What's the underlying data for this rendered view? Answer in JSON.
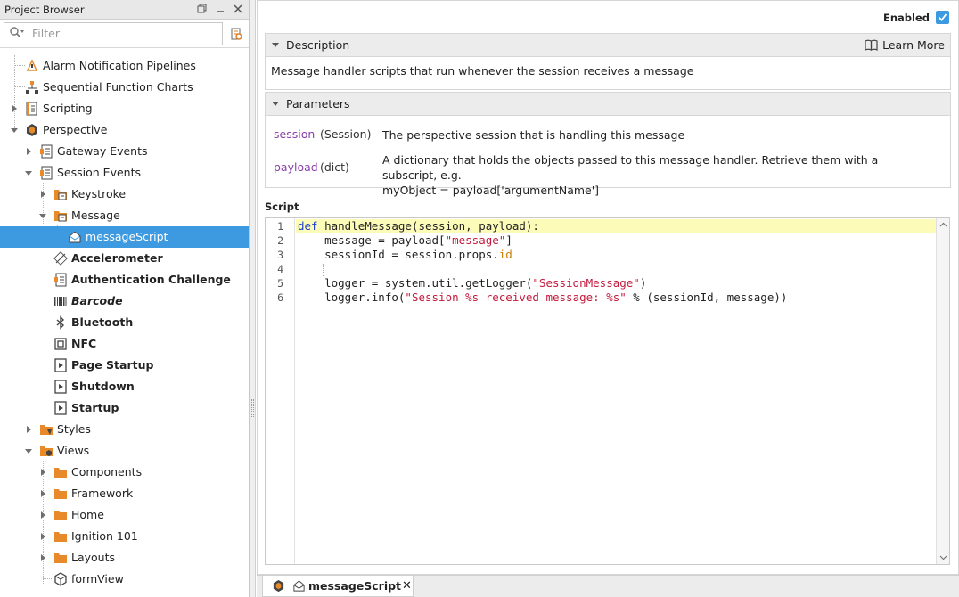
{
  "project_browser": {
    "title": "Project Browser",
    "filter_placeholder": "Filter",
    "tree": [
      {
        "label": "Alarm Notification Pipelines",
        "icon": "alarm-pipeline-icon"
      },
      {
        "label": "Sequential Function Charts",
        "icon": "sfc-icon"
      },
      {
        "label": "Scripting",
        "icon": "scripting-icon",
        "expanded": false
      },
      {
        "label": "Perspective",
        "icon": "perspective-icon",
        "expanded": true
      },
      {
        "label": "Gateway Events",
        "icon": "script-doc-icon",
        "expanded": false
      },
      {
        "label": "Session Events",
        "icon": "script-doc-icon",
        "expanded": true
      },
      {
        "label": "Keystroke",
        "icon": "folder-script-icon",
        "expanded": false
      },
      {
        "label": "Message",
        "icon": "folder-script-icon",
        "expanded": true
      },
      {
        "label": "messageScript",
        "icon": "message-script-icon",
        "selected": true
      },
      {
        "label": "Accelerometer",
        "icon": "accelerometer-icon"
      },
      {
        "label": "Authentication Challenge",
        "icon": "script-doc-icon"
      },
      {
        "label": "Barcode",
        "icon": "barcode-icon"
      },
      {
        "label": "Bluetooth",
        "icon": "bluetooth-icon"
      },
      {
        "label": "NFC",
        "icon": "nfc-icon"
      },
      {
        "label": "Page Startup",
        "icon": "page-play-icon"
      },
      {
        "label": "Shutdown",
        "icon": "page-play-icon"
      },
      {
        "label": "Startup",
        "icon": "page-play-icon"
      },
      {
        "label": "Styles",
        "icon": "folder-styles-icon",
        "expanded": false
      },
      {
        "label": "Views",
        "icon": "folder-views-icon",
        "expanded": true
      },
      {
        "label": "Components",
        "icon": "folder-icon",
        "expanded": false
      },
      {
        "label": "Framework",
        "icon": "folder-icon",
        "expanded": false
      },
      {
        "label": "Home",
        "icon": "folder-icon",
        "expanded": false
      },
      {
        "label": "Ignition 101",
        "icon": "folder-icon",
        "expanded": false
      },
      {
        "label": "Layouts",
        "icon": "folder-icon",
        "expanded": false
      },
      {
        "label": "formView",
        "icon": "view-icon"
      }
    ]
  },
  "editor": {
    "enabled_label": "Enabled",
    "enabled": true,
    "description": {
      "header": "Description",
      "learn_more": "Learn More",
      "text": "Message handler scripts that run whenever the session receives a message"
    },
    "parameters": {
      "header": "Parameters",
      "items": [
        {
          "name": "session",
          "type": "(Session)",
          "desc": "The perspective session that is handling this message"
        },
        {
          "name": "payload",
          "type": "(dict)",
          "desc_line1": "A dictionary that holds the objects passed to this message handler. Retrieve them with a subscript, e.g.",
          "desc_line2": "myObject = payload['argumentName']"
        }
      ]
    },
    "script_label": "Script",
    "code": {
      "line_numbers": [
        "1",
        "2",
        "3",
        "4",
        "5",
        "6"
      ],
      "l1": {
        "def": "def",
        "rest": " handleMessage(session, payload):"
      },
      "l2": {
        "a": "    message = payload[",
        "b": "\"message\"",
        "c": "]"
      },
      "l3": {
        "a": "    sessionId = session.props.",
        "b": "id"
      },
      "l5": {
        "a": "    logger = system.util.getLogger(",
        "b": "\"SessionMessage\"",
        "c": ")"
      },
      "l6": {
        "a": "    logger.info(",
        "b": "\"Session %s received message: %s\"",
        "c": " % (sessionId, message))"
      }
    }
  },
  "tabbar": {
    "tab_label": "messageScript",
    "close": "✕"
  },
  "colors": {
    "selection": "#3d9ae0",
    "keyword": "#1a3fd0",
    "string": "#c41a3c",
    "param_name": "#8a3fa8",
    "current_line": "#fdfbb8"
  }
}
